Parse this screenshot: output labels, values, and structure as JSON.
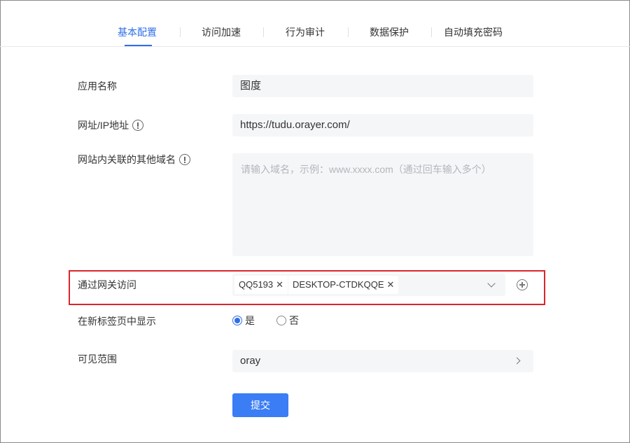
{
  "tabs": [
    {
      "label": "基本配置",
      "active": true
    },
    {
      "label": "访问加速",
      "active": false
    },
    {
      "label": "行为审计",
      "active": false
    },
    {
      "label": "数据保护",
      "active": false
    },
    {
      "label": "自动填充密码",
      "active": false
    }
  ],
  "form": {
    "app_name": {
      "label": "应用名称",
      "value": "图度"
    },
    "url": {
      "label": "网址/IP地址",
      "value": "https://tudu.orayer.com/",
      "info_icon": "info-circle-icon"
    },
    "other_domains": {
      "label": "网站内关联的其他域名",
      "placeholder": "请输入域名，示例：www.xxxx.com（通过回车输入多个）",
      "value": "",
      "info_icon": "info-circle-icon"
    },
    "gateway": {
      "label": "通过网关访问",
      "tags": [
        "QQ5193",
        "DESKTOP-CTDKQQE"
      ],
      "remove_glyph": "✕",
      "add_icon": "plus-circle-icon",
      "dropdown_icon": "chevron-down-icon"
    },
    "new_tab": {
      "label": "在新标签页中显示",
      "options": [
        {
          "label": "是",
          "checked": true
        },
        {
          "label": "否",
          "checked": false
        }
      ]
    },
    "visibility": {
      "label": "可见范围",
      "value": "oray",
      "icon": "chevron-right-icon"
    },
    "submit_label": "提交"
  },
  "colors": {
    "accent": "#2e6fe8",
    "highlight": "#d9262b",
    "field_bg": "#f5f6f8",
    "button": "#3a7df5"
  }
}
